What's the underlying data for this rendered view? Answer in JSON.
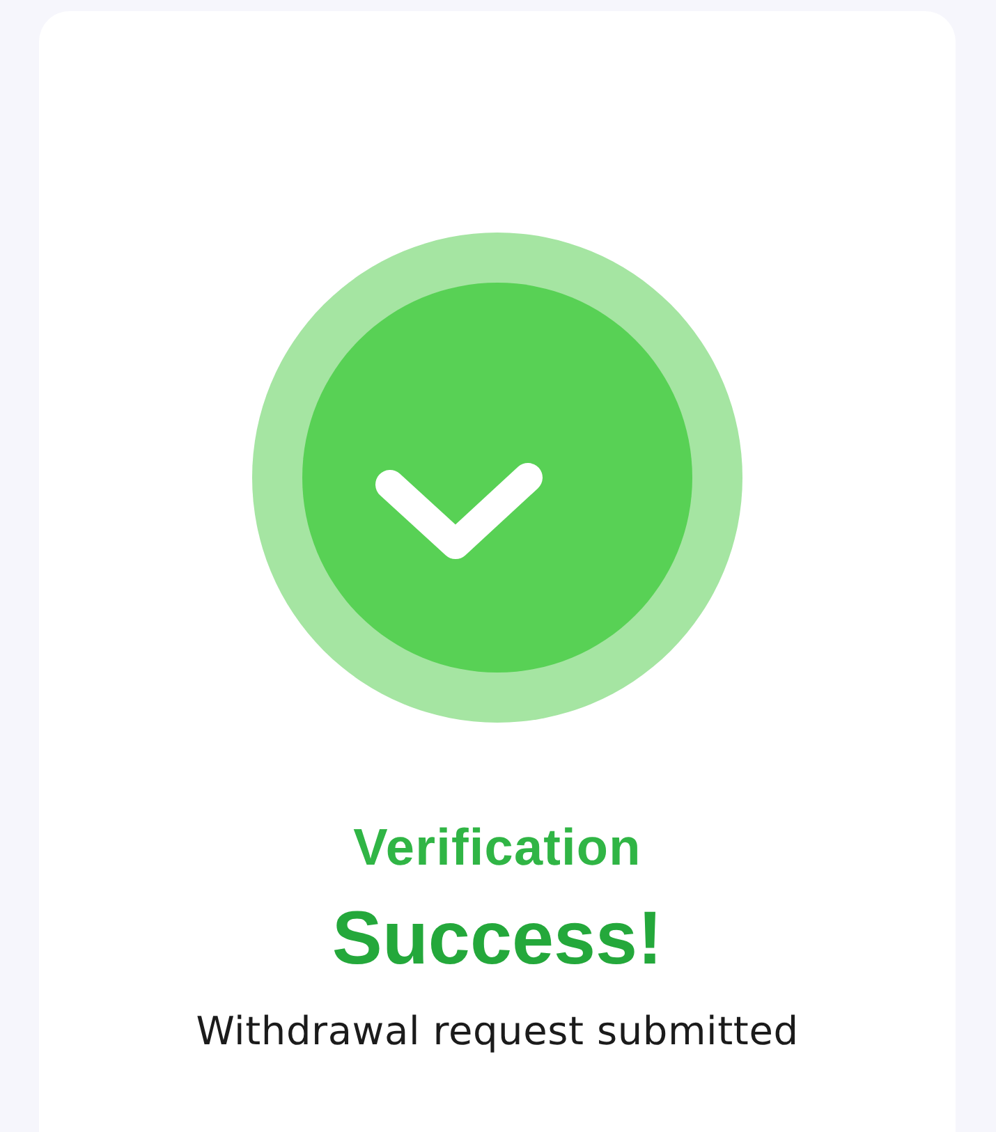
{
  "status": {
    "kind": "success",
    "title": "Verification",
    "headline": "Success!",
    "message": "Withdrawal request submitted"
  }
}
